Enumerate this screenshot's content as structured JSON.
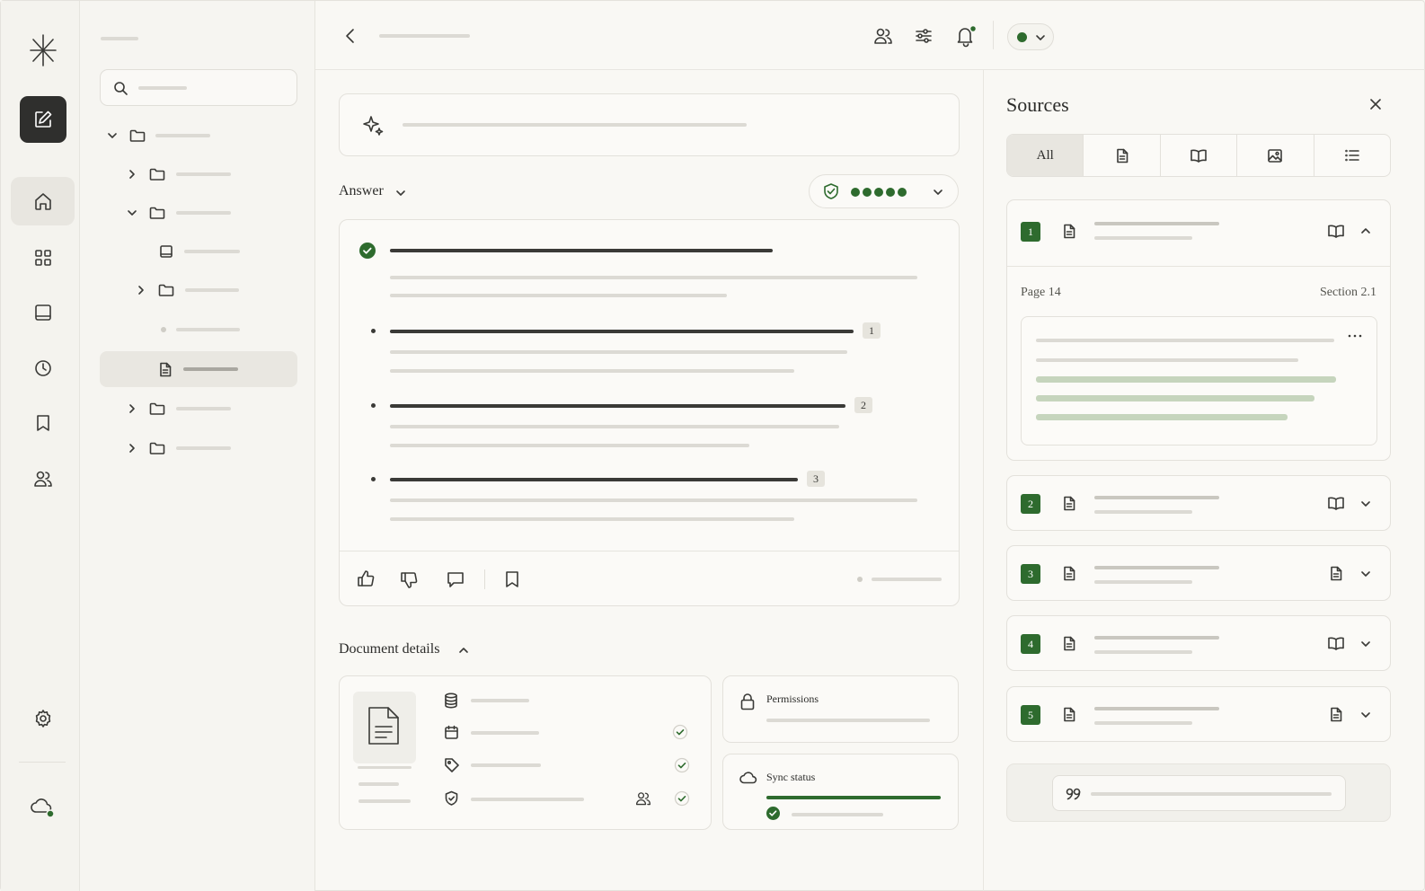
{
  "main": {
    "answer_label": "Answer",
    "citations": [
      "1",
      "2",
      "3"
    ],
    "details": {
      "title": "Document details",
      "permissions_label": "Permissions",
      "sync_label": "Sync status",
      "sync_progress": 1.0
    },
    "confidence_dots": 5
  },
  "sources": {
    "title": "Sources",
    "tabs": {
      "all": "All"
    },
    "expanded": {
      "page": "Page 14",
      "section": "Section 2.1"
    },
    "items": [
      "1",
      "2",
      "3",
      "4",
      "5"
    ]
  },
  "colors": {
    "accent": "#2e6b2e",
    "dark": "#2f2f2d"
  }
}
